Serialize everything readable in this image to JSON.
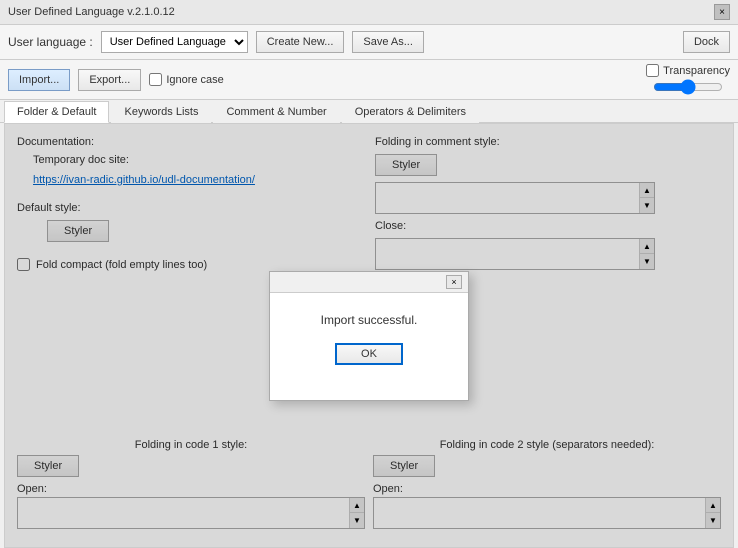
{
  "window": {
    "title": "User Defined Language v.2.1.0.12",
    "close_label": "×"
  },
  "toolbar": {
    "lang_label": "User language :",
    "lang_value": "User Defined Language",
    "create_new_label": "Create New...",
    "save_as_label": "Save As...",
    "dock_label": "Dock",
    "import_label": "Import...",
    "export_label": "Export...",
    "ignore_case_label": "Ignore case",
    "transparency_label": "Transparency"
  },
  "tabs": [
    {
      "label": "Folder & Default",
      "active": true
    },
    {
      "label": "Keywords Lists",
      "active": false
    },
    {
      "label": "Comment & Number",
      "active": false
    },
    {
      "label": "Operators & Delimiters",
      "active": false
    }
  ],
  "main": {
    "doc_section_label": "Documentation:",
    "temp_doc_label": "Temporary doc site:",
    "doc_link": "https://ivan-radic.github.io/udl-documentation/",
    "default_style_label": "Default style:",
    "styler_btn": "Styler",
    "fold_compact_label": "Fold compact (fold empty lines too)",
    "folding_comment_label": "Folding in comment style:",
    "folding_comment_styler": "Styler",
    "close_label": "Close:",
    "open_label": "Open:",
    "folding_code1_label": "Folding in code 1 style:",
    "folding_code1_styler": "Styler",
    "folding_code1_open": "Open:",
    "folding_code2_label": "Folding in code 2 style (separators needed):",
    "folding_code2_styler": "Styler",
    "folding_code2_open": "Open:"
  },
  "modal": {
    "message": "Import successful.",
    "ok_label": "OK"
  }
}
